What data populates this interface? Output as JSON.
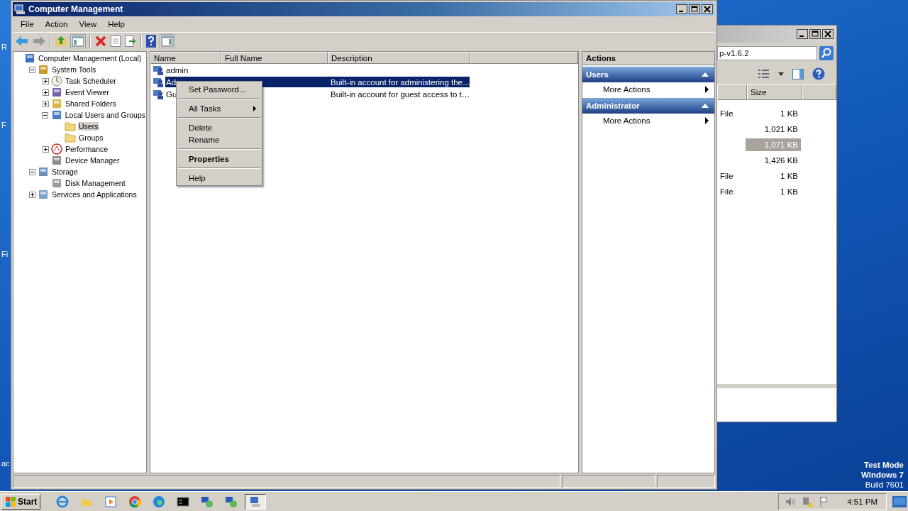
{
  "desktop": {
    "icon_labels": [
      "R",
      "F",
      "Fi",
      "ac"
    ],
    "os_notice": [
      {
        "text": "Test Mode",
        "bold": true
      },
      {
        "text": "Windows 7",
        "bold": true
      },
      {
        "text": "Build 7601",
        "bold": false
      }
    ]
  },
  "main_window": {
    "title": "Computer Management",
    "menu": [
      "File",
      "Action",
      "View",
      "Help"
    ],
    "tree": [
      {
        "label": "Computer Management (Local)",
        "kind": "computer",
        "selected": false,
        "children": [
          {
            "label": "System Tools",
            "kind": "tools",
            "expanded": true,
            "selected": false,
            "children": [
              {
                "label": "Task Scheduler",
                "kind": "clock",
                "expanded": false,
                "selected": false
              },
              {
                "label": "Event Viewer",
                "kind": "event",
                "expanded": false,
                "selected": false
              },
              {
                "label": "Shared Folders",
                "kind": "share",
                "expanded": false,
                "selected": false
              },
              {
                "label": "Local Users and Groups",
                "kind": "users",
                "expanded": true,
                "selected": false,
                "children": [
                  {
                    "label": "Users",
                    "kind": "folder",
                    "selected": true
                  },
                  {
                    "label": "Groups",
                    "kind": "folder",
                    "selected": false
                  }
                ]
              },
              {
                "label": "Performance",
                "kind": "perf",
                "expanded": false,
                "selected": false
              },
              {
                "label": "Device Manager",
                "kind": "device",
                "selected": false
              }
            ]
          },
          {
            "label": "Storage",
            "kind": "storage",
            "expanded": true,
            "selected": false,
            "children": [
              {
                "label": "Disk Management",
                "kind": "disk",
                "selected": false
              }
            ]
          },
          {
            "label": "Services and Applications",
            "kind": "services",
            "expanded": false,
            "selected": false
          }
        ]
      }
    ],
    "list": {
      "columns": [
        "Name",
        "Full Name",
        "Description"
      ],
      "rows": [
        {
          "name": "admin",
          "description": "",
          "selected": false
        },
        {
          "name": "Ad",
          "description": "Built-in account for administering the…",
          "selected": true
        },
        {
          "name": "Gu",
          "description": "Built-in account for guest access to t…",
          "selected": false
        }
      ]
    },
    "context_menu": [
      {
        "kind": "item",
        "label": "Set Password...",
        "submenu": false,
        "default": false
      },
      {
        "kind": "separator"
      },
      {
        "kind": "item",
        "label": "All Tasks",
        "submenu": true,
        "default": false
      },
      {
        "kind": "separator"
      },
      {
        "kind": "item",
        "label": "Delete",
        "submenu": false,
        "default": false
      },
      {
        "kind": "item",
        "label": "Rename",
        "submenu": false,
        "default": false
      },
      {
        "kind": "separator"
      },
      {
        "kind": "item",
        "label": "Properties",
        "submenu": false,
        "default": true
      },
      {
        "kind": "separator"
      },
      {
        "kind": "item",
        "label": "Help",
        "submenu": false,
        "default": false
      }
    ],
    "actions": {
      "title": "Actions",
      "sections": [
        {
          "title": "Users",
          "expanded": true,
          "items": [
            "More Actions"
          ]
        },
        {
          "title": "Administrator",
          "expanded": true,
          "items": [
            "More Actions"
          ]
        }
      ]
    }
  },
  "back_window": {
    "address": "p-v1.6.2",
    "size_column": "Size",
    "rows": [
      {
        "type": "File",
        "size": "1 KB",
        "selected": false
      },
      {
        "size": "1,021 KB",
        "selected": false
      },
      {
        "size": "1,071 KB",
        "selected": true
      },
      {
        "size": "1,426 KB",
        "selected": false
      },
      {
        "type": "File",
        "size": "1 KB",
        "selected": false
      },
      {
        "type": "File",
        "size": "1 KB",
        "selected": false
      }
    ]
  },
  "taskbar": {
    "start": "Start",
    "apps": [
      {
        "kind": "browser-e",
        "selected": false
      },
      {
        "kind": "folder",
        "selected": false
      },
      {
        "kind": "media",
        "selected": false
      },
      {
        "kind": "chrome",
        "selected": false
      },
      {
        "kind": "edge",
        "selected": false
      },
      {
        "kind": "console",
        "selected": false
      },
      {
        "kind": "remote",
        "selected": false
      },
      {
        "kind": "remote",
        "selected": false
      },
      {
        "kind": "mmc",
        "selected": true
      }
    ],
    "clock": "4:51 PM"
  }
}
